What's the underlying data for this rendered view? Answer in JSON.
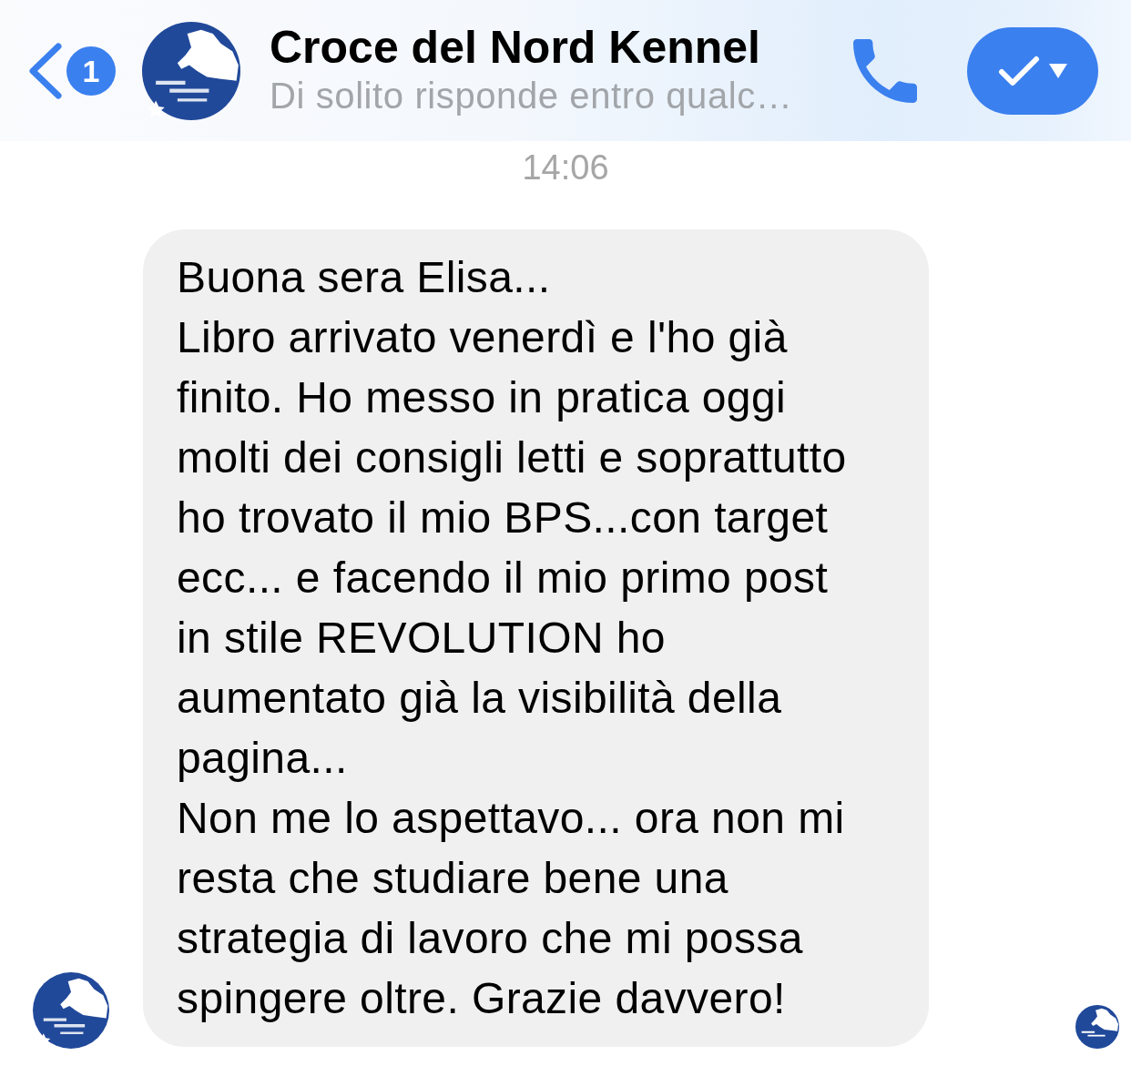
{
  "header": {
    "unread_badge": "1",
    "title": "Croce del Nord Kennel",
    "subtitle": "Di solito risponde entro qualc…"
  },
  "timestamp": "14:06",
  "messages": [
    {
      "text": "Buona sera Elisa...\nLibro arrivato venerdì e l'ho già\nfinito. Ho messo in pratica oggi\nmolti dei consigli letti e soprattutto\nho trovato il mio BPS...con target\necc... e facendo il mio primo post\nin stile REVOLUTION ho\naumentato già la visibilità della\npagina...\nNon me lo aspettavo... ora non mi\nresta che studiare bene una\nstrategia di lavoro che mi possa\nspingere oltre. Grazie davvero!",
      "seen": true
    }
  ]
}
